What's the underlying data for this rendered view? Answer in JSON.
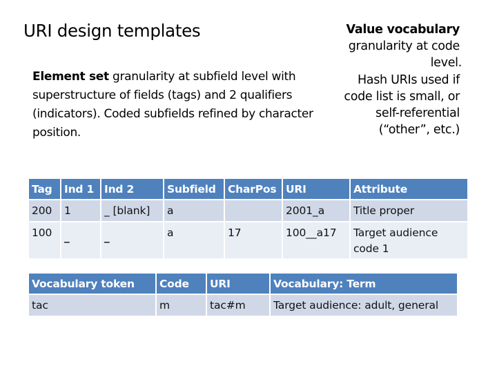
{
  "slide": {
    "title": "URI design templates"
  },
  "element_set_note": {
    "bold_lead": "Element set",
    "text": " granularity at subfield level with superstructure of fields (tags) and 2 qualifiers (indicators). Coded subfields refined by character position."
  },
  "value_vocab_note": {
    "bold_lead": "Value vocabulary",
    "line1": "granularity at code",
    "line2": "level.",
    "line3": "Hash URIs used if",
    "line4": "code list is small, or",
    "line5": "self-referential",
    "line6": "(“other”, etc.)"
  },
  "marc_table": {
    "columns": [
      "Tag",
      "Ind 1",
      "Ind 2",
      "Subfield",
      "CharPos",
      "URI",
      "Attribute"
    ],
    "rows": [
      [
        "200",
        "1",
        "_ [blank]",
        "a",
        "",
        "2001_a",
        "Title proper"
      ],
      [
        "100",
        "_",
        "_",
        "a",
        "17",
        "100__a17",
        "Target audience code 1"
      ]
    ]
  },
  "vocab_table": {
    "columns": [
      "Vocabulary token",
      "Code",
      "URI",
      "Vocabulary: Term"
    ],
    "rows": [
      [
        "tac",
        "m",
        "tac#m",
        "Target audience: adult, general"
      ]
    ]
  },
  "colors": {
    "header_bg": "#4f81bd",
    "row_odd_bg": "#d0d8e8",
    "row_even_bg": "#e9edf4"
  }
}
